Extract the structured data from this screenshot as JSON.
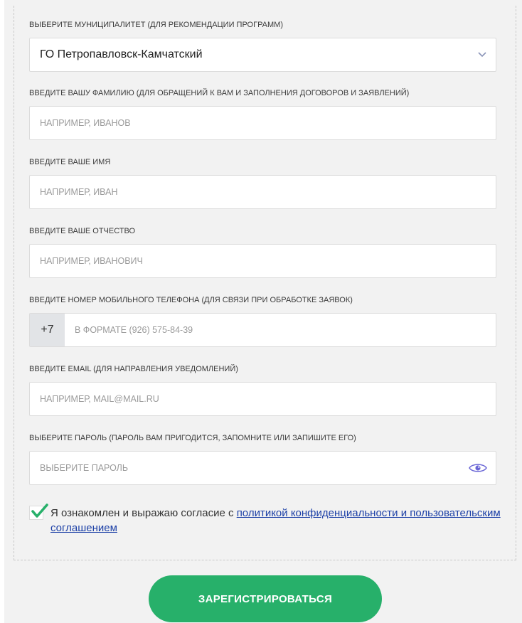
{
  "municipality": {
    "label": "Выберите муниципалитет (для рекомендации программ)",
    "value": "ГО Петропавловск-Камчатский",
    "icon": "chevron-down-icon"
  },
  "surname": {
    "label": "Введите вашу фамилию (для обращений к вам и заполнения договоров и заявлений)",
    "placeholder": "Например, Иванов"
  },
  "first_name": {
    "label": "Введите ваше имя",
    "placeholder": "Например, Иван"
  },
  "patronymic": {
    "label": "Введите ваше отчество",
    "placeholder": "Например, Иванович"
  },
  "phone": {
    "label": "Введите номер мобильного телефона (для связи при обработке заявок)",
    "prefix": "+7",
    "placeholder": "в формате (926) 575-84-39"
  },
  "email": {
    "label": "Введите email (для направления уведомлений)",
    "placeholder": "Например, mail@mail.ru"
  },
  "password": {
    "label": "Выберите пароль (пароль вам пригодится, запомните или запишите его)",
    "placeholder": "Выберите пароль",
    "icon": "eye-icon"
  },
  "consent": {
    "checked": true,
    "text": "Я ознакомлен и выражаю согласие с ",
    "link_text": "политикой конфиденциальности и пользовательским соглашением"
  },
  "submit": {
    "label": "ЗАРЕГИСТРИРОВАТЬСЯ"
  },
  "colors": {
    "accent_green": "#27b06a",
    "link_blue": "#1b3fa6",
    "eye_icon": "#6a66d6",
    "chevron": "#8a94b8"
  }
}
